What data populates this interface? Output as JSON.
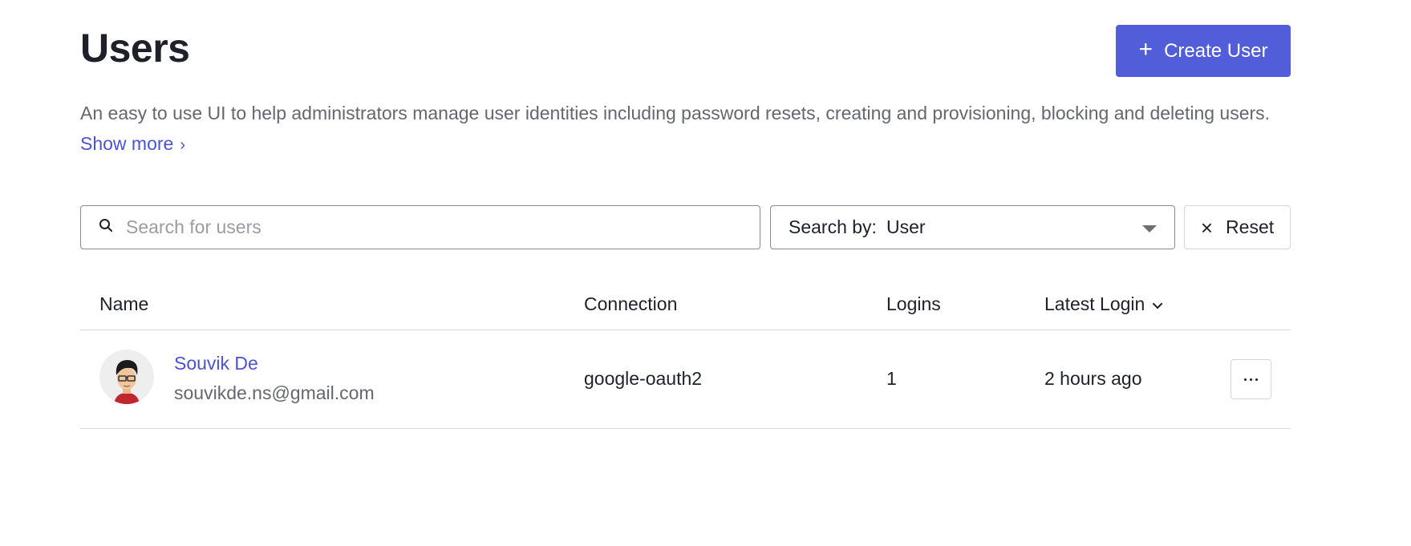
{
  "page": {
    "title": "Users",
    "description": "An easy to use UI to help administrators manage user identities including password resets, creating and provisioning, blocking and deleting users.",
    "show_more_label": "Show more",
    "show_more_icon": "chevron-right-icon"
  },
  "actions": {
    "create_user_label": "Create User",
    "create_user_icon": "plus-icon",
    "accent_color": "#525dd9"
  },
  "filters": {
    "search_placeholder": "Search for users",
    "search_value": "",
    "search_icon": "search-icon",
    "search_by_label": "Search by:",
    "search_by_value": "User",
    "reset_label": "Reset",
    "reset_icon": "close-icon"
  },
  "table": {
    "columns": [
      {
        "label": "Name"
      },
      {
        "label": "Connection"
      },
      {
        "label": "Logins"
      },
      {
        "label": "Latest Login",
        "sorted": "desc"
      }
    ],
    "rows": [
      {
        "name": "Souvik De",
        "email": "souvikde.ns@gmail.com",
        "connection": "google-oauth2",
        "logins": "1",
        "latest_login": "2 hours ago",
        "avatar": "avatar-image"
      }
    ]
  }
}
